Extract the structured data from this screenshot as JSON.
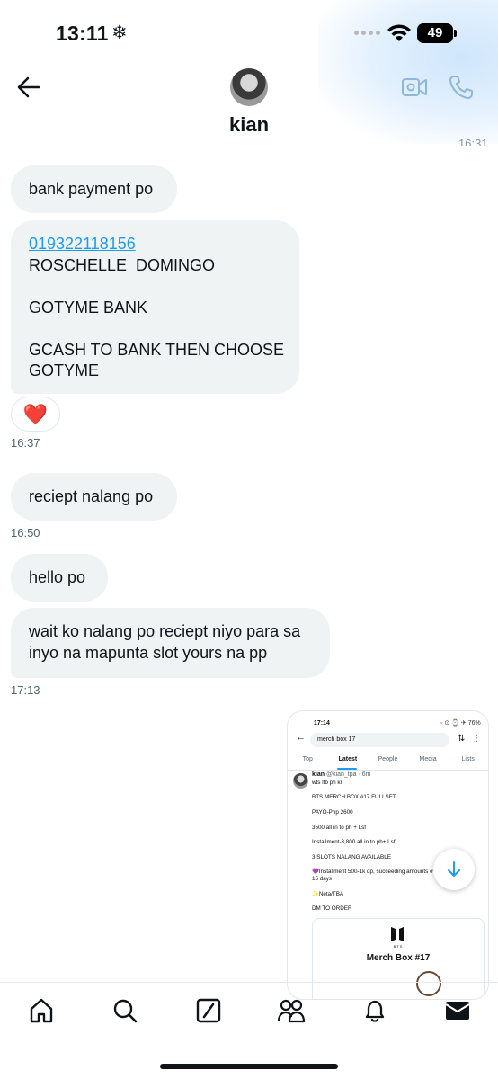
{
  "status_bar": {
    "time": "13:11",
    "snow_glyph": "❄",
    "battery": "49"
  },
  "header": {
    "name": "kian",
    "clipped_timestamp": "16:31"
  },
  "messages": [
    {
      "text": "bank payment po"
    },
    {
      "lines": [
        "019322118156",
        "ROSCHELLE  DOMINGO",
        "",
        "GOTYME BANK",
        "",
        "GCASH TO BANK THEN CHOOSE",
        "GOTYME"
      ]
    },
    {
      "reaction": "❤️",
      "timestamp": "16:37"
    },
    {
      "text": "reciept nalang po",
      "timestamp": "16:50"
    },
    {
      "text": "hello po"
    },
    {
      "lines": [
        "wait ko nalang po reciept niyo para sa",
        "inyo na mapunta slot yours na pp"
      ],
      "timestamp": "17:13"
    }
  ],
  "attachment": {
    "status_time": "17:14",
    "status_right": "◦ ⊙ ⌚ ✈ 76%",
    "search_query": "merch box 17",
    "tabs": [
      "Top",
      "Latest",
      "People",
      "Media",
      "Lists"
    ],
    "author": "kian",
    "handle": "@kian_tpa · 6m",
    "lines": [
      "wts lfb ph kr",
      "BTS MERCH BOX #17 FULLSET",
      "PAYO-Php 2600",
      "3500 all in to ph + Lsf",
      "Installment-3,800 all in to ph+ Lsf",
      "3 SLOTS NALANG AVAILABLE",
      "💜Installment 500-1k dp, succeeding amounts every",
      "15 days",
      "✨Neta/TBA",
      "DM TO ORDER"
    ],
    "card_brand": "BTS",
    "card_title": "Merch Box #17"
  },
  "nav": [
    "home-icon",
    "search-icon",
    "grok-icon",
    "communities-icon",
    "notifications-icon",
    "messages-icon"
  ],
  "colors": {
    "bubble": "#eff3f4",
    "link": "#1d9bf0",
    "text": "#0f1419",
    "muted": "#536471"
  }
}
